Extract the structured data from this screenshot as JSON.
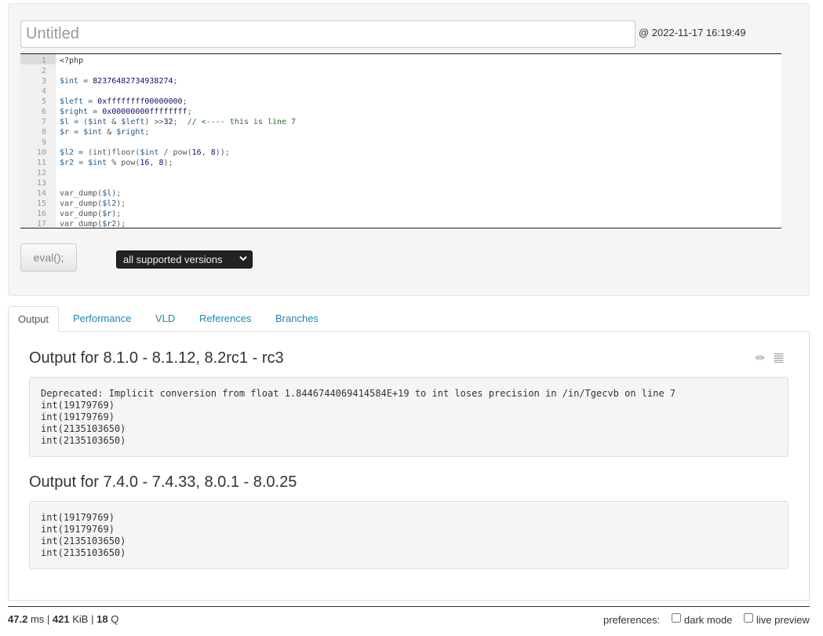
{
  "header": {
    "title_placeholder": "Untitled",
    "timestamp": "@ 2022-11-17 16:19:49"
  },
  "editor": {
    "lines": [
      {
        "n": "1",
        "tokens": [
          {
            "t": "<?php",
            "c": "kw"
          }
        ]
      },
      {
        "n": "2",
        "tokens": []
      },
      {
        "n": "3",
        "tokens": [
          {
            "t": "$int",
            "c": "var"
          },
          {
            "t": " = ",
            "c": "op"
          },
          {
            "t": "82376482734938274",
            "c": "hex"
          },
          {
            "t": ";",
            "c": "op"
          }
        ]
      },
      {
        "n": "4",
        "tokens": []
      },
      {
        "n": "5",
        "tokens": [
          {
            "t": "$left",
            "c": "var"
          },
          {
            "t": " = ",
            "c": "op"
          },
          {
            "t": "0xffffffff00000000",
            "c": "hex"
          },
          {
            "t": ";",
            "c": "op"
          }
        ]
      },
      {
        "n": "6",
        "tokens": [
          {
            "t": "$right",
            "c": "var"
          },
          {
            "t": " = ",
            "c": "op"
          },
          {
            "t": "0x00000000ffffffff",
            "c": "hex"
          },
          {
            "t": ";",
            "c": "op"
          }
        ]
      },
      {
        "n": "7",
        "tokens": [
          {
            "t": "$l",
            "c": "var"
          },
          {
            "t": " = (",
            "c": "op"
          },
          {
            "t": "$int",
            "c": "var"
          },
          {
            "t": " & ",
            "c": "op"
          },
          {
            "t": "$left",
            "c": "var"
          },
          {
            "t": ") >>",
            "c": "op"
          },
          {
            "t": "32",
            "c": "hex"
          },
          {
            "t": ";  ",
            "c": "op"
          },
          {
            "t": "// <---- this is line 7",
            "c": "com"
          }
        ]
      },
      {
        "n": "8",
        "tokens": [
          {
            "t": "$r",
            "c": "var"
          },
          {
            "t": " = ",
            "c": "op"
          },
          {
            "t": "$int",
            "c": "var"
          },
          {
            "t": " & ",
            "c": "op"
          },
          {
            "t": "$right",
            "c": "var"
          },
          {
            "t": ";",
            "c": "op"
          }
        ]
      },
      {
        "n": "9",
        "tokens": []
      },
      {
        "n": "10",
        "tokens": [
          {
            "t": "$l2",
            "c": "var"
          },
          {
            "t": " = (int)floor(",
            "c": "op"
          },
          {
            "t": "$int",
            "c": "var"
          },
          {
            "t": " / pow(",
            "c": "op"
          },
          {
            "t": "16",
            "c": "hex"
          },
          {
            "t": ", ",
            "c": "op"
          },
          {
            "t": "8",
            "c": "hex"
          },
          {
            "t": "));",
            "c": "op"
          }
        ]
      },
      {
        "n": "11",
        "tokens": [
          {
            "t": "$r2",
            "c": "var"
          },
          {
            "t": " = ",
            "c": "op"
          },
          {
            "t": "$int",
            "c": "var"
          },
          {
            "t": " % pow(",
            "c": "op"
          },
          {
            "t": "16",
            "c": "hex"
          },
          {
            "t": ", ",
            "c": "op"
          },
          {
            "t": "8",
            "c": "hex"
          },
          {
            "t": ");",
            "c": "op"
          }
        ]
      },
      {
        "n": "12",
        "tokens": []
      },
      {
        "n": "13",
        "tokens": []
      },
      {
        "n": "14",
        "tokens": [
          {
            "t": "var_dump(",
            "c": "op"
          },
          {
            "t": "$l",
            "c": "var"
          },
          {
            "t": ");",
            "c": "op"
          }
        ]
      },
      {
        "n": "15",
        "tokens": [
          {
            "t": "var_dump(",
            "c": "op"
          },
          {
            "t": "$l2",
            "c": "var"
          },
          {
            "t": ");",
            "c": "op"
          }
        ]
      },
      {
        "n": "16",
        "tokens": [
          {
            "t": "var_dump(",
            "c": "op"
          },
          {
            "t": "$r",
            "c": "var"
          },
          {
            "t": ");",
            "c": "op"
          }
        ]
      },
      {
        "n": "17",
        "tokens": [
          {
            "t": "var_dump(",
            "c": "op"
          },
          {
            "t": "$r2",
            "c": "var"
          },
          {
            "t": ");",
            "c": "op"
          }
        ]
      }
    ]
  },
  "controls": {
    "eval_label": "eval();",
    "version_selected": "all supported versions"
  },
  "tabs": [
    {
      "label": "Output",
      "active": true
    },
    {
      "label": "Performance"
    },
    {
      "label": "VLD"
    },
    {
      "label": "References"
    },
    {
      "label": "Branches"
    }
  ],
  "outputs": [
    {
      "heading": "Output for 8.1.0 - 8.1.12, 8.2rc1 - rc3",
      "lines": [
        "Deprecated: Implicit conversion from float 1.8446744069414584E+19 to int loses precision in /in/Tgecvb on line 7",
        "int(19179769)",
        "int(19179769)",
        "int(2135103650)",
        "int(2135103650)"
      ]
    },
    {
      "heading": "Output for 7.4.0 - 7.4.33, 8.0.1 - 8.0.25",
      "lines": [
        "int(19179769)",
        "int(19179769)",
        "int(2135103650)",
        "int(2135103650)"
      ]
    }
  ],
  "footer": {
    "time_value": "47.2",
    "time_unit": "ms",
    "sep1": "|",
    "mem_value": "421",
    "mem_unit": "KiB",
    "sep2": "|",
    "queries_value": "18",
    "queries_unit": "Q",
    "preferences_label": "preferences:",
    "dark_mode_label": "dark mode",
    "live_preview_label": "live preview"
  },
  "icons": {
    "eye": "eye-icon",
    "list": "list-icon",
    "caret": "chevron-down-icon"
  }
}
